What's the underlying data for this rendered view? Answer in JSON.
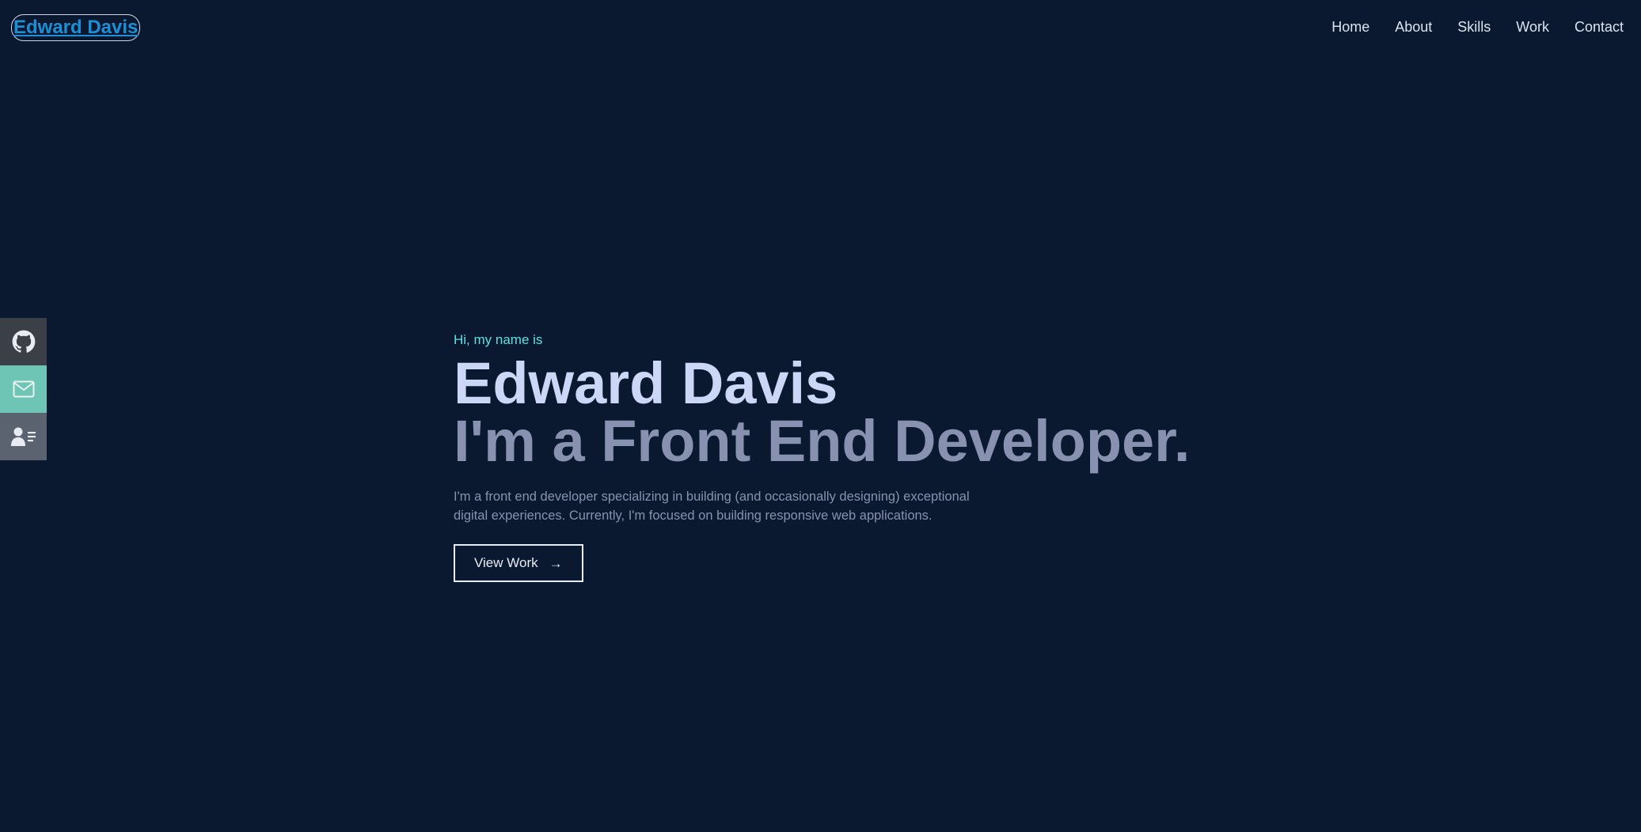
{
  "header": {
    "logo_text": "Edward Davis",
    "nav": [
      {
        "label": "Home"
      },
      {
        "label": "About"
      },
      {
        "label": "Skills"
      },
      {
        "label": "Work"
      },
      {
        "label": "Contact"
      }
    ]
  },
  "social": {
    "items": [
      {
        "icon": "github-icon",
        "color": "#3b3f47"
      },
      {
        "icon": "mail-icon",
        "color": "#6ec5b5"
      },
      {
        "icon": "resume-icon",
        "color": "#5b6270"
      }
    ]
  },
  "hero": {
    "greeting": "Hi, my name is",
    "name": "Edward Davis",
    "role": "I'm a Front End Developer.",
    "bio": "I'm a front end developer specializing in building (and occasionally designing) exceptional digital experiences. Currently, I'm focused on building responsive web applications.",
    "cta_label": "View Work",
    "cta_icon": "arrow-right-icon"
  },
  "colors": {
    "background": "#0a192f",
    "accent": "#5ce0e6",
    "logo": "#1c8fd6",
    "name": "#ccd6f6",
    "muted": "#8892b0"
  }
}
